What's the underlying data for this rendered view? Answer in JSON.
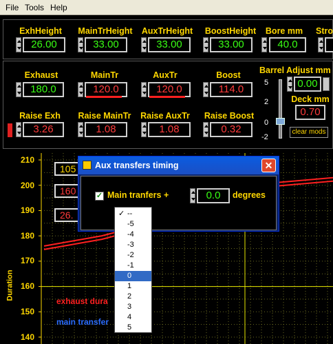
{
  "menu": {
    "file": "File",
    "tools": "Tools",
    "help": "Help"
  },
  "top_panel": {
    "fields": [
      {
        "label": "ExhHeight",
        "value": "26.00"
      },
      {
        "label": "MainTrHeight",
        "value": "33.00"
      },
      {
        "label": "AuxTrHeight",
        "value": "33.00"
      },
      {
        "label": "BoostHeight",
        "value": "33.00"
      },
      {
        "label": "Bore mm",
        "value": "40.0"
      },
      {
        "label": "Stro"
      }
    ]
  },
  "mid_panel": {
    "timing": [
      {
        "label": "Exhaust",
        "value": "180.0"
      },
      {
        "label": "MainTr",
        "value": "120.0"
      },
      {
        "label": "AuxTr",
        "value": "120.0"
      },
      {
        "label": "Boost",
        "value": "114.0"
      }
    ],
    "raise": [
      {
        "label": "Raise Exh",
        "value": "3.26"
      },
      {
        "label": "Raise MainTr",
        "value": "1.08"
      },
      {
        "label": "Raise AuxTr",
        "value": "1.08"
      },
      {
        "label": "Raise Boost",
        "value": "0.32"
      }
    ],
    "barrel_adjust": {
      "label": "Barrel Adjust mm",
      "value": "0.00"
    },
    "deck": {
      "label": "Deck mm",
      "value": "0.70"
    },
    "slider_ticks": [
      "5",
      "2",
      "0",
      "-2"
    ],
    "clear_mods": "clear mods"
  },
  "chart": {
    "y_ticks": [
      "210",
      "200",
      "190",
      "180",
      "170",
      "160",
      "150",
      "140"
    ],
    "ylabel": "Duration",
    "behind_values": [
      "105",
      "160",
      "26."
    ],
    "legend": [
      {
        "label": "exhaust dura",
        "color": "#ff2020"
      },
      {
        "label": "main transfer",
        "color": "#2a6cff"
      }
    ]
  },
  "chart_data": {
    "type": "line",
    "ylabel": "Duration",
    "ylim": [
      140,
      210
    ],
    "y_ticks": [
      210,
      200,
      190,
      180,
      170,
      160,
      150,
      140
    ],
    "grid": true,
    "series": [
      {
        "name": "exhaust dura",
        "values": [
          176,
          178,
          180,
          183,
          187,
          192,
          196,
          199,
          201,
          202,
          203
        ]
      },
      {
        "name": "main transfer",
        "values": []
      }
    ]
  },
  "dialog": {
    "title": "Aux transfers timing",
    "checkbox_label": "Main tranfers +",
    "value": "0.0",
    "unit": "degrees"
  },
  "dropdown": {
    "items": [
      "--",
      "-5",
      "-4",
      "-3",
      "-2",
      "-1",
      "0",
      "1",
      "2",
      "3",
      "4",
      "5"
    ],
    "checked": "--",
    "selected": "0"
  }
}
